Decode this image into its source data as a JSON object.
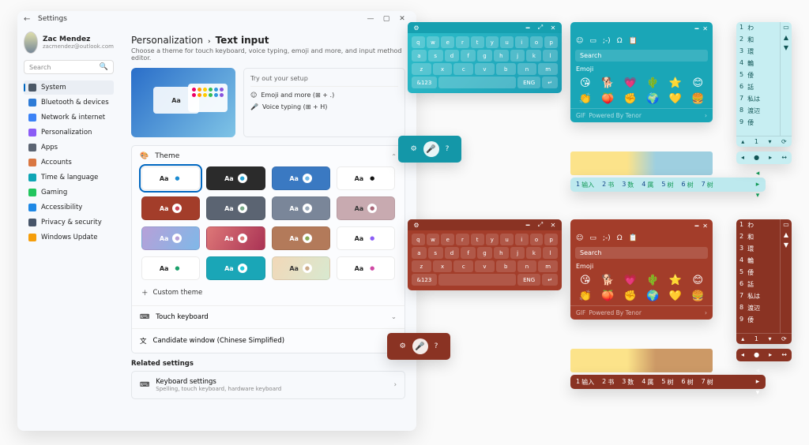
{
  "titlebar": {
    "title": "Settings"
  },
  "user": {
    "name": "Zac Mendez",
    "email": "zacmendez@outlook.com"
  },
  "search": {
    "placeholder": "Search"
  },
  "nav": [
    {
      "label": "System",
      "color": "#4a5766"
    },
    {
      "label": "Bluetooth & devices",
      "color": "#2e7bd6"
    },
    {
      "label": "Network & internet",
      "color": "#3b82f6"
    },
    {
      "label": "Personalization",
      "color": "#8b5cf6"
    },
    {
      "label": "Apps",
      "color": "#5b6472"
    },
    {
      "label": "Accounts",
      "color": "#d97742"
    },
    {
      "label": "Time & language",
      "color": "#0ea5b5"
    },
    {
      "label": "Gaming",
      "color": "#22c55e"
    },
    {
      "label": "Accessibility",
      "color": "#1e88e5"
    },
    {
      "label": "Privacy & security",
      "color": "#475569"
    },
    {
      "label": "Windows Update",
      "color": "#f59e0b"
    }
  ],
  "crumbs": {
    "a": "Personalization",
    "sep": "›",
    "b": "Text input"
  },
  "subtitle": "Choose a theme for touch keyboard, voice typing, emoji and more, and input method editor.",
  "hero": {
    "aa": "Aa"
  },
  "try": {
    "title": "Try out your setup",
    "emoji": "Emoji and more (⊞ + .)",
    "voice": "Voice typing (⊞ + H)"
  },
  "theme": {
    "title": "Theme",
    "custom": "Custom theme",
    "swatches": [
      {
        "bg": "#ffffff",
        "fg": "#222",
        "mic": "#1b8bd1",
        "sel": true
      },
      {
        "bg": "#2b2b2b",
        "fg": "#fff",
        "mic": "#2aa4d4"
      },
      {
        "bg": "#3a79c2",
        "fg": "#fff",
        "mic": "#6fb8e8"
      },
      {
        "bg": "#ffffff",
        "fg": "#222",
        "mic": "#111"
      },
      {
        "bg": "#a33d2a",
        "fg": "#fff",
        "mic": "#c45"
      },
      {
        "bg": "#5b6472",
        "fg": "#fff",
        "mic": "#7a8"
      },
      {
        "bg": "#7a8699",
        "fg": "#fff",
        "mic": "#9ab"
      },
      {
        "bg": "#c8aab0",
        "fg": "#333",
        "mic": "#a67"
      },
      {
        "bg": "linear-gradient(120deg,#b7a0d8,#7fb8e8)",
        "fg": "#fff",
        "mic": "#b7a0d8"
      },
      {
        "bg": "linear-gradient(120deg,#d77,#a35)",
        "fg": "#fff",
        "mic": "#d77"
      },
      {
        "bg": "#b37a5a",
        "fg": "#fff",
        "mic": "#8a5"
      },
      {
        "bg": "#ffffff",
        "fg": "#222",
        "mic": "#8b5cf6"
      },
      {
        "bg": "#ffffff",
        "fg": "#222",
        "mic": "#1aa06a"
      },
      {
        "bg": "#1aa6b7",
        "fg": "#fff",
        "mic": "#2cd"
      },
      {
        "bg": "linear-gradient(120deg,#f2d8b8,#d8e9d0)",
        "fg": "#333",
        "mic": "#ca8"
      },
      {
        "bg": "#ffffff",
        "fg": "#222",
        "mic": "#d048a4"
      }
    ]
  },
  "rows": {
    "touch": "Touch keyboard",
    "candidate": "Candidate window (Chinese Simplified)"
  },
  "related": {
    "heading": "Related settings",
    "kb": "Keyboard settings",
    "kbsub": "Spelling, touch keyboard, hardware keyboard"
  },
  "kbrows": [
    [
      "q",
      "w",
      "e",
      "r",
      "t",
      "y",
      "u",
      "i",
      "o",
      "p"
    ],
    [
      "a",
      "s",
      "d",
      "f",
      "g",
      "h",
      "j",
      "k",
      "l"
    ],
    [
      "z",
      "x",
      "c",
      "v",
      "b",
      "n",
      "m"
    ]
  ],
  "kbbottom": {
    "num": "&123",
    "lang": "ENG"
  },
  "emoji": {
    "search": "Search",
    "label": "Emoji",
    "gif": "GIF",
    "tenor": "Powered By Tenor",
    "set": [
      "😘",
      "🐕",
      "💗",
      "🌵",
      "⭐",
      "😊",
      "👏",
      "🍑",
      "✊",
      "🌍",
      "💛",
      "🍔"
    ]
  },
  "cand": {
    "items": [
      [
        "1",
        "输入"
      ],
      [
        "2",
        "书"
      ],
      [
        "3",
        "数"
      ],
      [
        "4",
        "属"
      ],
      [
        "5",
        "树"
      ],
      [
        "6",
        "树"
      ],
      [
        "7",
        "树"
      ]
    ]
  },
  "jp": {
    "items": [
      [
        "1",
        "わ"
      ],
      [
        "2",
        "和"
      ],
      [
        "3",
        "環"
      ],
      [
        "4",
        "輪"
      ],
      [
        "5",
        "倭"
      ],
      [
        "6",
        "話"
      ],
      [
        "7",
        "私は"
      ],
      [
        "8",
        "渡辺"
      ],
      [
        "9",
        "倭"
      ]
    ]
  }
}
